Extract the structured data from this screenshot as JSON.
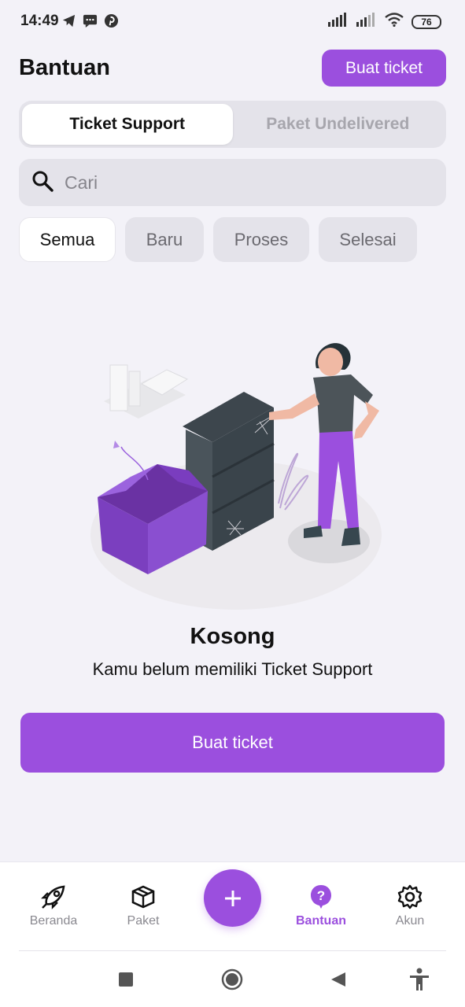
{
  "status_bar": {
    "time": "14:49",
    "notification_icons": [
      "telegram-icon",
      "message-icon",
      "pinterest-icon"
    ],
    "battery": "76"
  },
  "header": {
    "title": "Bantuan",
    "create_button": "Buat ticket"
  },
  "tabs": [
    {
      "label": "Ticket Support",
      "active": true
    },
    {
      "label": "Paket Undelivered",
      "active": false
    }
  ],
  "search": {
    "placeholder": "Cari",
    "value": ""
  },
  "filters": [
    {
      "label": "Semua",
      "active": true
    },
    {
      "label": "Baru",
      "active": false
    },
    {
      "label": "Proses",
      "active": false
    },
    {
      "label": "Selesai",
      "active": false
    }
  ],
  "empty_state": {
    "title": "Kosong",
    "message": "Kamu belum memiliki Ticket Support",
    "button": "Buat ticket"
  },
  "bottom_nav": [
    {
      "label": "Beranda",
      "icon": "rocket-icon",
      "active": false
    },
    {
      "label": "Paket",
      "icon": "box-icon",
      "active": false
    },
    {
      "label": "Bantuan",
      "icon": "help-icon",
      "active": true
    },
    {
      "label": "Akun",
      "icon": "gear-icon",
      "active": false
    }
  ],
  "colors": {
    "accent": "#9b4fde",
    "background": "#f3f2f8",
    "surface": "#e4e3ea"
  }
}
